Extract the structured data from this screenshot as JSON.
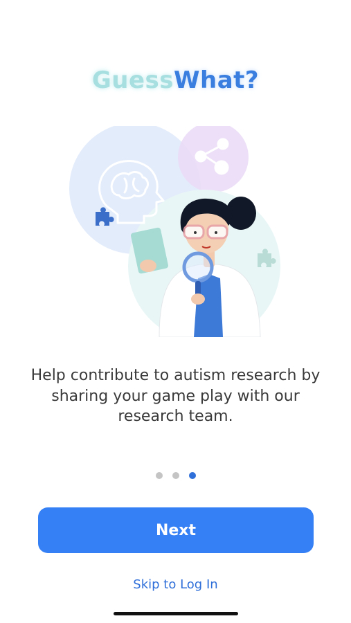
{
  "logo": {
    "part1": "Guess",
    "part2": "What?"
  },
  "illustration": {
    "icons": [
      "brain-head-icon",
      "share-network-icon",
      "puzzle-piece-icon",
      "magnifying-glass-icon",
      "clipboard-icon"
    ]
  },
  "onboarding": {
    "description": "Help contribute to autism research by sharing your game play with our research team.",
    "page_count": 3,
    "active_page": 3
  },
  "actions": {
    "next_label": "Next",
    "skip_label": "Skip to Log In"
  },
  "colors": {
    "accent": "#3580f5",
    "link": "#2f6fd9",
    "logo_guess": "#a7dfe0",
    "logo_what": "#3a7fe0"
  }
}
